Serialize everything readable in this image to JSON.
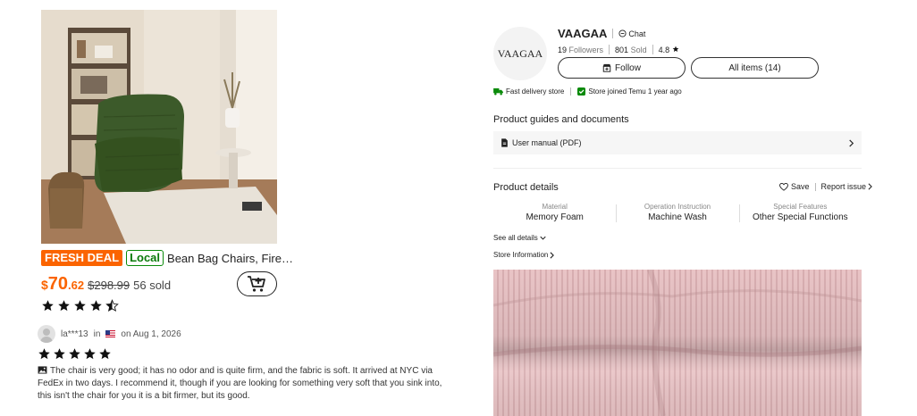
{
  "product": {
    "badge_deal": "FRESH DEAL",
    "badge_local": "Local",
    "title": "Bean Bag Chairs, Firepl...",
    "price_currency": "$",
    "price_int": "70",
    "price_dec": ".62",
    "price_original": "$298.99",
    "sold": "56 sold",
    "rating": 4.5
  },
  "review": {
    "user": "la***13",
    "in_label": "in",
    "date_label": "on Aug 1, 2026",
    "stars": 5,
    "text": "The chair is very good; it has no odor and is quite firm, and the fabric is soft. It arrived at NYC via FedEx in two days. I recommend it, though if you are looking for something very soft that you sink into, this isn't the chair for you it is a bit firmer, but its good."
  },
  "store": {
    "logo_text": "VAAGAA",
    "name": "VAAGAA",
    "chat_label": "Chat",
    "followers_value": "19",
    "followers_label": "Followers",
    "sold_value": "801",
    "sold_label": "Sold",
    "rating": "4.8",
    "follow_label": "Follow",
    "all_items_label": "All items (14)",
    "tag_delivery": "Fast delivery store",
    "tag_joined": "Store joined Temu 1 year ago"
  },
  "guides": {
    "title": "Product guides and documents",
    "manual_label": "User manual (PDF)"
  },
  "details": {
    "title": "Product details",
    "save_label": "Save",
    "report_label": "Report issue",
    "attributes": [
      {
        "label": "Material",
        "value": "Memory Foam"
      },
      {
        "label": "Operation Instruction",
        "value": "Machine Wash"
      },
      {
        "label": "Special Features",
        "value": "Other Special Functions"
      }
    ],
    "see_all_label": "See all details",
    "store_info_label": "Store Information"
  },
  "colors": {
    "accent": "#fb6400",
    "local_green": "#0a8a0a",
    "chair_green": "#3c5a2a",
    "pink_fabric": "#e8c2c4"
  }
}
